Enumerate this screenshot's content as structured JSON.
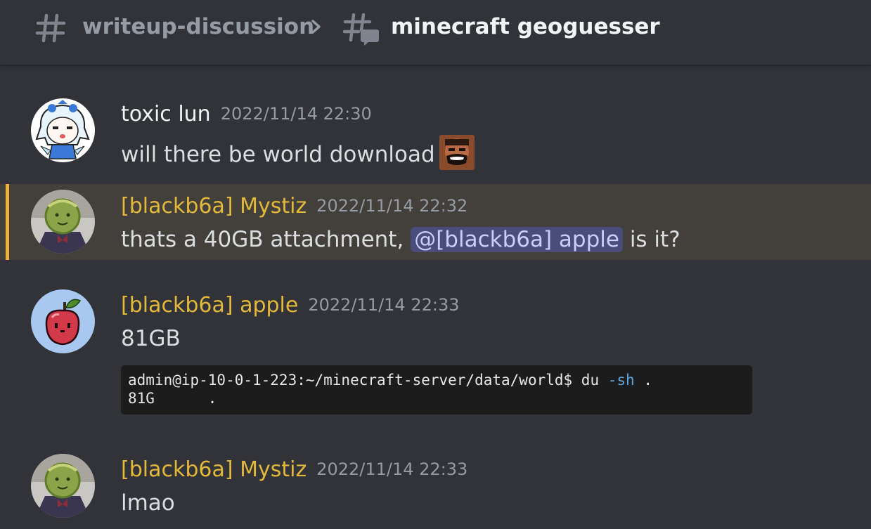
{
  "header": {
    "parent_channel": "writeup-discussion",
    "thread_title": "minecraft geoguesser"
  },
  "messages": [
    {
      "author": "toxic lun",
      "timestamp": "2022/11/14 22:30",
      "text": "will there be world download",
      "emoji": "laughing-face-emoji"
    },
    {
      "author": "[blackb6a] Mystiz",
      "timestamp": "2022/11/14 22:32",
      "text_before": "thats a 40GB attachment,",
      "mention": "@[blackb6a] apple",
      "text_after": "is it?"
    },
    {
      "author": "[blackb6a] apple",
      "timestamp": "2022/11/14 22:33",
      "text": "81GB",
      "attachment": {
        "prompt": "admin@ip-10-0-1-223:~/minecraft-server/data/world$ du",
        "flag": "-sh",
        "arg": ".",
        "output_size": "81G",
        "output_path": "."
      }
    },
    {
      "author": "[blackb6a] Mystiz",
      "timestamp": "2022/11/14 22:33",
      "text": "lmao"
    }
  ],
  "colors": {
    "background": "#313338",
    "highlight_bg": "#433f3b",
    "highlight_bar": "#f0b232",
    "role_gold": "#e3b93b",
    "mention_bg": "#4a4d7a",
    "mention_text": "#c9cdfb"
  }
}
